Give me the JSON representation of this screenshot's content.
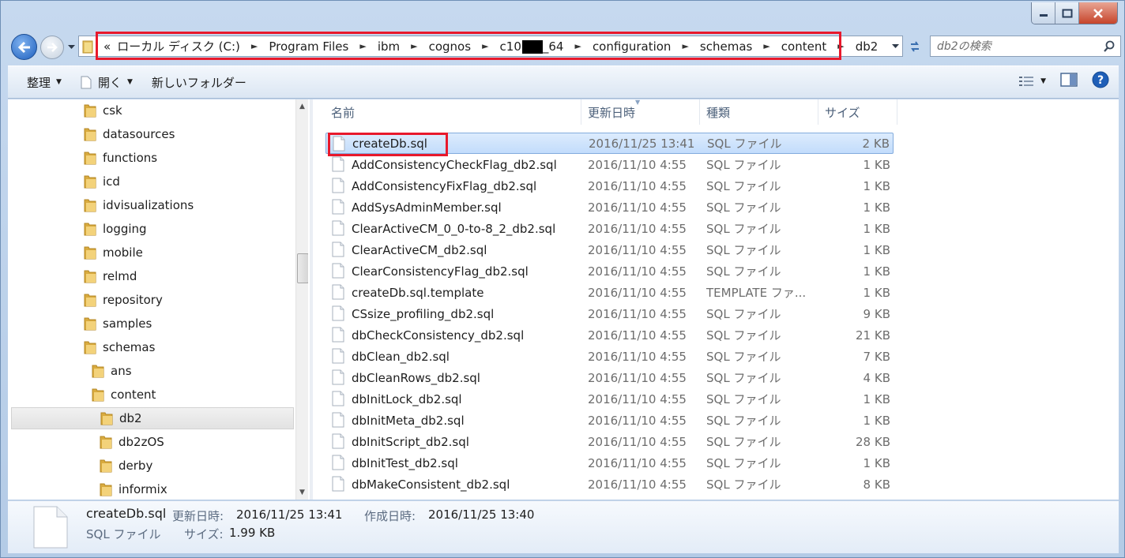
{
  "address": {
    "overflow": "«",
    "crumbs": [
      "ローカル ディスク (C:)",
      "Program Files",
      "ibm",
      "cognos"
    ],
    "version_prefix": "c10",
    "version_suffix": "_64",
    "crumbs_after": [
      "configuration",
      "schemas",
      "content",
      "db2"
    ],
    "highlight_color": "#e8192c"
  },
  "search": {
    "placeholder": "db2の検索"
  },
  "toolbar": {
    "organize_label": "整理",
    "open_label": "開く",
    "new_folder_label": "新しいフォルダー"
  },
  "nav_tree": [
    {
      "label": "csk",
      "level": 0
    },
    {
      "label": "datasources",
      "level": 0
    },
    {
      "label": "functions",
      "level": 0
    },
    {
      "label": "icd",
      "level": 0
    },
    {
      "label": "idvisualizations",
      "level": 0
    },
    {
      "label": "logging",
      "level": 0
    },
    {
      "label": "mobile",
      "level": 0
    },
    {
      "label": "relmd",
      "level": 0
    },
    {
      "label": "repository",
      "level": 0
    },
    {
      "label": "samples",
      "level": 0
    },
    {
      "label": "schemas",
      "level": 0
    },
    {
      "label": "ans",
      "level": 1
    },
    {
      "label": "content",
      "level": 1
    },
    {
      "label": "db2",
      "level": 2,
      "selected": true
    },
    {
      "label": "db2zOS",
      "level": 2
    },
    {
      "label": "derby",
      "level": 2
    },
    {
      "label": "informix",
      "level": 2
    }
  ],
  "columns": {
    "name": "名前",
    "date": "更新日時",
    "type": "種類",
    "size": "サイズ"
  },
  "files": [
    {
      "name": "createDb.sql",
      "date": "2016/11/25 13:41",
      "type": "SQL ファイル",
      "size": "2 KB",
      "selected": true
    },
    {
      "name": "AddConsistencyCheckFlag_db2.sql",
      "date": "2016/11/10 4:55",
      "type": "SQL ファイル",
      "size": "1 KB"
    },
    {
      "name": "AddConsistencyFixFlag_db2.sql",
      "date": "2016/11/10 4:55",
      "type": "SQL ファイル",
      "size": "1 KB"
    },
    {
      "name": "AddSysAdminMember.sql",
      "date": "2016/11/10 4:55",
      "type": "SQL ファイル",
      "size": "1 KB"
    },
    {
      "name": "ClearActiveCM_0_0-to-8_2_db2.sql",
      "date": "2016/11/10 4:55",
      "type": "SQL ファイル",
      "size": "1 KB"
    },
    {
      "name": "ClearActiveCM_db2.sql",
      "date": "2016/11/10 4:55",
      "type": "SQL ファイル",
      "size": "1 KB"
    },
    {
      "name": "ClearConsistencyFlag_db2.sql",
      "date": "2016/11/10 4:55",
      "type": "SQL ファイル",
      "size": "1 KB"
    },
    {
      "name": "createDb.sql.template",
      "date": "2016/11/10 4:55",
      "type": "TEMPLATE ファ...",
      "size": "1 KB"
    },
    {
      "name": "CSsize_profiling_db2.sql",
      "date": "2016/11/10 4:55",
      "type": "SQL ファイル",
      "size": "9 KB"
    },
    {
      "name": "dbCheckConsistency_db2.sql",
      "date": "2016/11/10 4:55",
      "type": "SQL ファイル",
      "size": "21 KB"
    },
    {
      "name": "dbClean_db2.sql",
      "date": "2016/11/10 4:55",
      "type": "SQL ファイル",
      "size": "7 KB"
    },
    {
      "name": "dbCleanRows_db2.sql",
      "date": "2016/11/10 4:55",
      "type": "SQL ファイル",
      "size": "4 KB"
    },
    {
      "name": "dbInitLock_db2.sql",
      "date": "2016/11/10 4:55",
      "type": "SQL ファイル",
      "size": "1 KB"
    },
    {
      "name": "dbInitMeta_db2.sql",
      "date": "2016/11/10 4:55",
      "type": "SQL ファイル",
      "size": "1 KB"
    },
    {
      "name": "dbInitScript_db2.sql",
      "date": "2016/11/10 4:55",
      "type": "SQL ファイル",
      "size": "28 KB"
    },
    {
      "name": "dbInitTest_db2.sql",
      "date": "2016/11/10 4:55",
      "type": "SQL ファイル",
      "size": "1 KB"
    },
    {
      "name": "dbMakeConsistent_db2.sql",
      "date": "2016/11/10 4:55",
      "type": "SQL ファイル",
      "size": "8 KB"
    }
  ],
  "details": {
    "name": "createDb.sql",
    "modified_label": "更新日時:",
    "modified_value": "2016/11/25 13:41",
    "created_label": "作成日時:",
    "created_value": "2016/11/25 13:40",
    "type": "SQL ファイル",
    "size_label": "サイズ:",
    "size_value": "1.99 KB"
  }
}
